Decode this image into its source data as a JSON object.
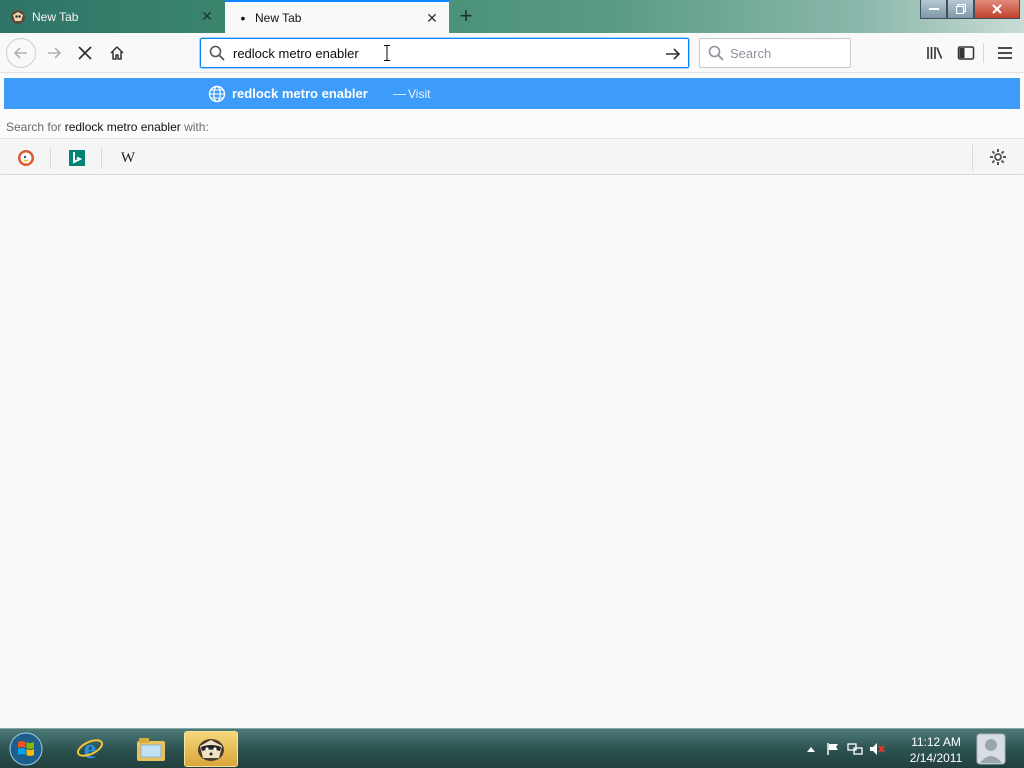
{
  "tabs": [
    {
      "title": "New Tab",
      "active": false,
      "icon": "firefox-nightly-icon"
    },
    {
      "title": "New Tab",
      "active": true,
      "icon": "loading-dot"
    }
  ],
  "urlbar": {
    "value": "redlock metro enabler"
  },
  "searchbar": {
    "placeholder": "Search"
  },
  "autocomplete": {
    "title": "redlock metro enabler",
    "separator": "—",
    "action": "Visit",
    "search_prefix": "Search for ",
    "search_term": "redlock metro enabler",
    "search_suffix": " with:",
    "engines": [
      {
        "name": "DuckDuckGo",
        "icon": "duckduckgo-icon"
      },
      {
        "name": "Bing",
        "icon": "bing-icon"
      },
      {
        "name": "Wikipedia",
        "icon": "wikipedia-icon",
        "glyph": "W"
      }
    ]
  },
  "taskbar": {
    "apps": [
      "internet-explorer",
      "windows-explorer",
      "firefox"
    ],
    "clock_time": "11:12 AM",
    "clock_date": "2/14/2011"
  },
  "colors": {
    "accent": "#0a84ff",
    "highlight": "#3d9bf9"
  }
}
